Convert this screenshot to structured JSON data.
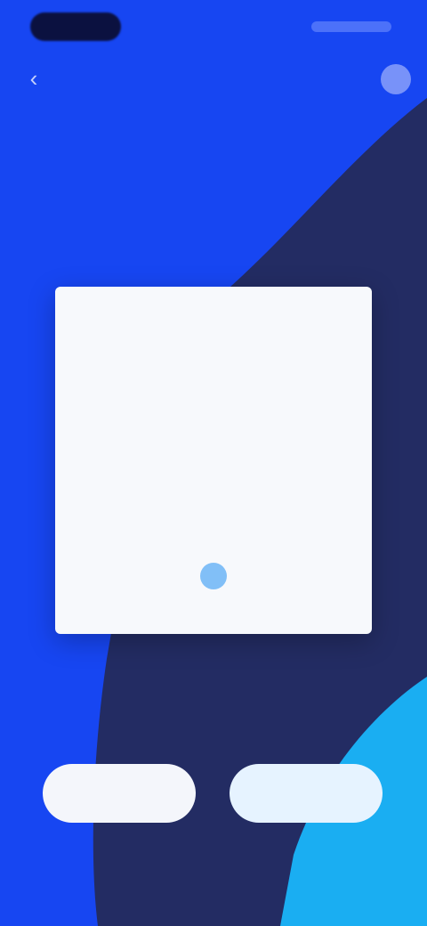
{
  "header": {
    "back_icon": "chevron-left-icon",
    "title": "",
    "menu_icon": "more-icon",
    "sub_link": ""
  },
  "card": {
    "header": "",
    "text": "",
    "dot_icon": "circle-icon"
  },
  "caption": "",
  "buttons": {
    "left_label": "",
    "right_label": ""
  },
  "colors": {
    "primary_blue": "#1746F2",
    "navy": "#232C63",
    "sky_blue": "#1AAEF2",
    "card_bg": "#F7F9FC"
  }
}
